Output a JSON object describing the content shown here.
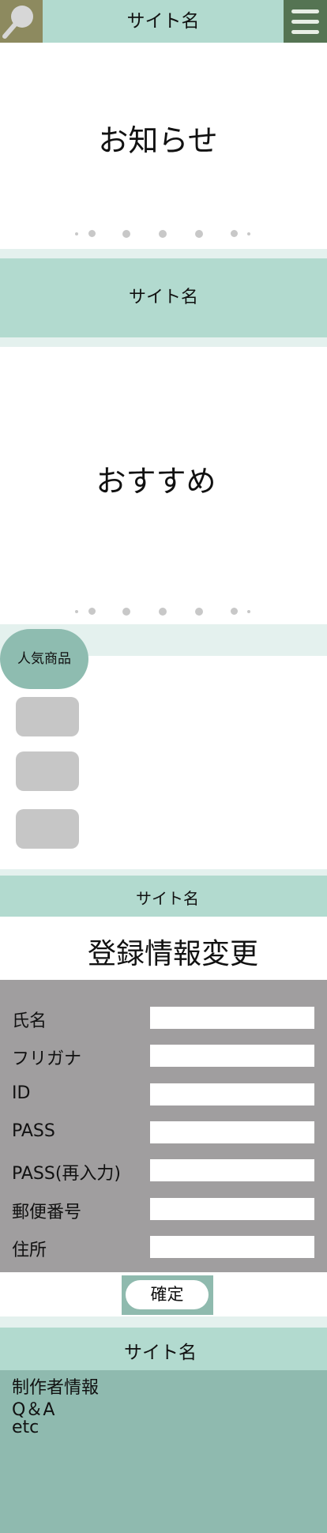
{
  "header": {
    "title": "サイト名",
    "search_icon": "search-icon",
    "menu_icon": "hamburger-menu-icon",
    "colors": {
      "bar": "#b2dacf",
      "search": "#8d8a5f",
      "menu": "#557453"
    }
  },
  "slider_news": {
    "title": "お知らせ",
    "page_dots": 7
  },
  "banner_1": {
    "title": "サイト名"
  },
  "slider_recommend": {
    "title": "おすすめ",
    "page_dots": 7
  },
  "popular": {
    "label": "人気商品",
    "items": 3
  },
  "banner_2": {
    "title": "サイト名"
  },
  "registration": {
    "heading": "登録情報変更",
    "fields": [
      {
        "label": "氏名",
        "value": ""
      },
      {
        "label": "フリガナ",
        "value": ""
      },
      {
        "label": "ID",
        "value": ""
      },
      {
        "label": "PASS",
        "value": ""
      },
      {
        "label": "PASS(再入力)",
        "value": ""
      },
      {
        "label": "郵便番号",
        "value": ""
      },
      {
        "label": "住所",
        "value": ""
      }
    ],
    "confirm_label": "確定"
  },
  "footer": {
    "title": "サイト名",
    "links": [
      "制作者情報",
      "Q＆A",
      "etc"
    ],
    "colors": {
      "band": "#b2dacf",
      "body": "#8fbaaf"
    }
  }
}
